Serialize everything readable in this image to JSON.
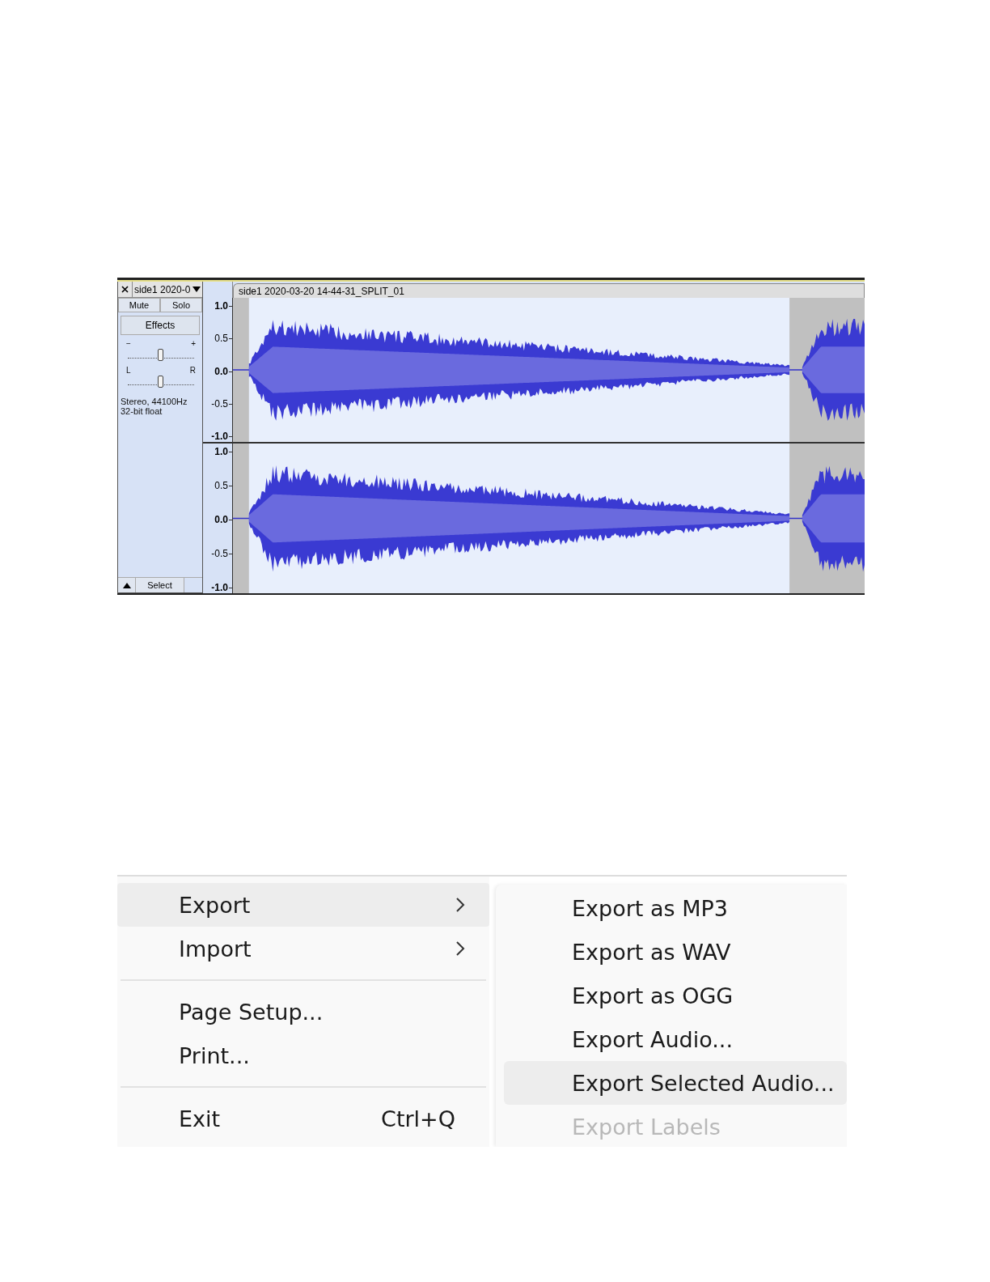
{
  "audio_editor": {
    "track_name": "side1 2020-0",
    "clip_title": "side1 2020-03-20 14-44-31_SPLIT_01",
    "buttons": [
      {
        "label": "Mute"
      },
      {
        "label": "Solo"
      }
    ],
    "effects": "Effects",
    "gain": {
      "minus": "−",
      "plus": "+",
      "level": 0.5
    },
    "pan": {
      "left": "L",
      "right": "R",
      "level": 0.5
    },
    "info": [
      "Stereo, 44100Hz",
      "32-bit float"
    ],
    "select": "Select",
    "channels": [
      {
        "ticks": [
          {
            "label": "1.0",
            "major": true
          },
          {
            "label": "0.5",
            "major": false
          },
          {
            "label": "0.0",
            "major": true
          },
          {
            "label": "-0.5",
            "major": false
          },
          {
            "label": "-1.0",
            "major": true
          }
        ]
      },
      {
        "ticks": [
          {
            "label": "1.0",
            "major": true
          },
          {
            "label": "0.5",
            "major": false
          },
          {
            "label": "0.0",
            "major": true
          },
          {
            "label": "-0.5",
            "major": false
          },
          {
            "label": "-1.0",
            "major": true
          }
        ]
      }
    ]
  },
  "file_menu": {
    "items": [
      {
        "kind": "item",
        "label": "Export",
        "submenu": true,
        "selected": true
      },
      {
        "kind": "item",
        "label": "Import",
        "submenu": true,
        "selected": false
      },
      {
        "kind": "separator"
      },
      {
        "kind": "item",
        "label": "Page Setup...",
        "submenu": false,
        "selected": false
      },
      {
        "kind": "item",
        "label": "Print...",
        "submenu": false,
        "selected": false
      },
      {
        "kind": "separator"
      },
      {
        "kind": "item",
        "label": "Exit",
        "shortcut": "Ctrl+Q",
        "submenu": false,
        "selected": false
      }
    ]
  },
  "export_submenu": {
    "items": [
      {
        "label": "Export as MP3",
        "selected": false,
        "disabled": false
      },
      {
        "label": "Export as WAV",
        "selected": false,
        "disabled": false
      },
      {
        "label": "Export as OGG",
        "selected": false,
        "disabled": false
      },
      {
        "label": "Export Audio...",
        "selected": false,
        "disabled": false
      },
      {
        "label": "Export Selected Audio...",
        "selected": true,
        "disabled": false
      },
      {
        "label": "Export Labels",
        "selected": false,
        "disabled": true
      }
    ]
  }
}
